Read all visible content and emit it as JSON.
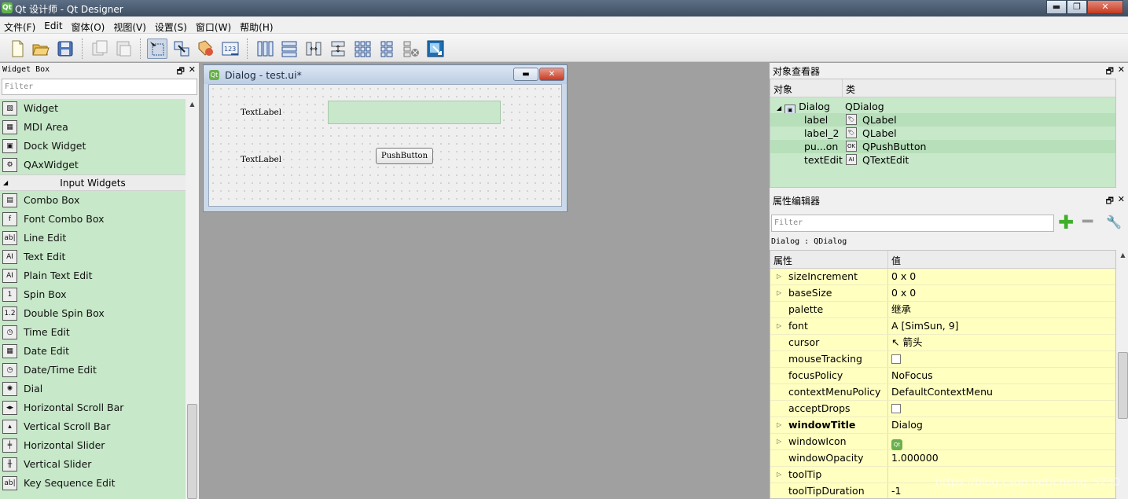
{
  "window": {
    "title": "Qt 设计师 - Qt Designer",
    "app_icon": "Qt",
    "minimize": "▬",
    "maximize": "❐",
    "close": "✕"
  },
  "menu": [
    "文件(F)",
    "Edit",
    "窗体(O)",
    "视图(V)",
    "设置(S)",
    "窗口(W)",
    "帮助(H)"
  ],
  "toolbar_icons": [
    "new-file-icon",
    "open-folder-icon",
    "save-icon",
    "copy-icon",
    "paste-icon",
    "edit-widgets-icon",
    "edit-signals-slots-icon",
    "edit-buddies-icon",
    "edit-tab-order-icon",
    "layout-horizontal-icon",
    "layout-vertical-icon",
    "layout-horizontal-splitter-icon",
    "layout-vertical-splitter-icon",
    "layout-grid-icon",
    "layout-form-icon",
    "break-layout-icon",
    "adjust-size-icon"
  ],
  "widget_box": {
    "title": "Widget Box",
    "filter_placeholder": "Filter",
    "float_glyph": "🗗",
    "close_glyph": "✕",
    "items_top": [
      {
        "label": "Widget",
        "icon": "widget-icon",
        "glyph": "▨"
      },
      {
        "label": "MDI Area",
        "icon": "mdi-area-icon",
        "glyph": "▦"
      },
      {
        "label": "Dock Widget",
        "icon": "dock-widget-icon",
        "glyph": "▣"
      },
      {
        "label": "QAxWidget",
        "icon": "qaxwidget-icon",
        "glyph": "⚙"
      }
    ],
    "category": "Input Widgets",
    "category_glyph": "◢",
    "items_input": [
      {
        "label": "Combo Box",
        "icon": "combo-box-icon",
        "glyph": "▤"
      },
      {
        "label": "Font Combo Box",
        "icon": "font-combo-box-icon",
        "glyph": "f"
      },
      {
        "label": "Line Edit",
        "icon": "line-edit-icon",
        "glyph": "ab|"
      },
      {
        "label": "Text Edit",
        "icon": "text-edit-icon",
        "glyph": "AI"
      },
      {
        "label": "Plain Text Edit",
        "icon": "plain-text-edit-icon",
        "glyph": "AI"
      },
      {
        "label": "Spin Box",
        "icon": "spin-box-icon",
        "glyph": "1"
      },
      {
        "label": "Double Spin Box",
        "icon": "double-spin-box-icon",
        "glyph": "1.2"
      },
      {
        "label": "Time Edit",
        "icon": "time-edit-icon",
        "glyph": "◷"
      },
      {
        "label": "Date Edit",
        "icon": "date-edit-icon",
        "glyph": "▦"
      },
      {
        "label": "Date/Time Edit",
        "icon": "date-time-edit-icon",
        "glyph": "◷"
      },
      {
        "label": "Dial",
        "icon": "dial-icon",
        "glyph": "✺"
      },
      {
        "label": "Horizontal Scroll Bar",
        "icon": "horizontal-scroll-bar-icon",
        "glyph": "◂▸"
      },
      {
        "label": "Vertical Scroll Bar",
        "icon": "vertical-scroll-bar-icon",
        "glyph": "▴"
      },
      {
        "label": "Horizontal Slider",
        "icon": "horizontal-slider-icon",
        "glyph": "╪"
      },
      {
        "label": "Vertical Slider",
        "icon": "vertical-slider-icon",
        "glyph": "╫"
      },
      {
        "label": "Key Sequence Edit",
        "icon": "key-sequence-edit-icon",
        "glyph": "ab|"
      }
    ]
  },
  "dialog": {
    "title": "Dialog - test.ui*",
    "icon": "Qt",
    "minimize": "▬",
    "close": "✕",
    "label1": "TextLabel",
    "label2": "TextLabel",
    "button": "PushButton"
  },
  "object_inspector": {
    "title": "对象查看器",
    "col_object": "对象",
    "col_class": "类",
    "float_glyph": "🗗",
    "close_glyph": "✕",
    "rows": [
      {
        "name": "Dialog",
        "class": "QDialog",
        "icon": "dialog-icon",
        "glyph": "▣",
        "expanded_glyph": "◢"
      },
      {
        "name": "label",
        "class": "QLabel",
        "icon": "label-icon",
        "glyph": "🏷"
      },
      {
        "name": "label_2",
        "class": "QLabel",
        "icon": "label-icon",
        "glyph": "🏷"
      },
      {
        "name": "pu...on",
        "class": "QPushButton",
        "icon": "push-button-icon",
        "glyph": "OK"
      },
      {
        "name": "textEdit",
        "class": "QTextEdit",
        "icon": "text-edit-icon",
        "glyph": "AI"
      }
    ]
  },
  "property_editor": {
    "title": "属性编辑器",
    "filter_placeholder": "Filter",
    "plus": "✚",
    "minus": "━",
    "wrench": "🔧",
    "float_glyph": "🗗",
    "close_glyph": "✕",
    "class_line": "Dialog : QDialog",
    "col_property": "属性",
    "col_value": "值",
    "rows": [
      {
        "name": "sizeIncrement",
        "value": "0 x 0",
        "expandable": "▷"
      },
      {
        "name": "baseSize",
        "value": "0 x 0",
        "expandable": "▷"
      },
      {
        "name": "palette",
        "value": "继承",
        "expandable": ""
      },
      {
        "name": "font",
        "value": "A  [SimSun, 9]",
        "expandable": "▷"
      },
      {
        "name": "cursor",
        "value": "↖  箭头",
        "expandable": ""
      },
      {
        "name": "mouseTracking",
        "value": "",
        "checkbox": true,
        "expandable": ""
      },
      {
        "name": "focusPolicy",
        "value": "NoFocus",
        "expandable": ""
      },
      {
        "name": "contextMenuPolicy",
        "value": "DefaultContextMenu",
        "expandable": ""
      },
      {
        "name": "acceptDrops",
        "value": "",
        "checkbox": true,
        "expandable": ""
      },
      {
        "name": "windowTitle",
        "value": "Dialog",
        "expandable": "▷",
        "bold": true
      },
      {
        "name": "windowIcon",
        "value": "Qt",
        "expandable": "▷"
      },
      {
        "name": "windowOpacity",
        "value": "1.000000",
        "expandable": ""
      },
      {
        "name": "toolTip",
        "value": "",
        "expandable": "▷"
      },
      {
        "name": "toolTipDuration",
        "value": "-1",
        "expandable": ""
      }
    ]
  },
  "watermark": "https://blog.csdn.net/cheng_5230",
  "colors": {
    "widget_box_bg": "#c7e8c9",
    "property_bg": "#ffffbf",
    "mdi_bg": "#a0a0a0"
  }
}
